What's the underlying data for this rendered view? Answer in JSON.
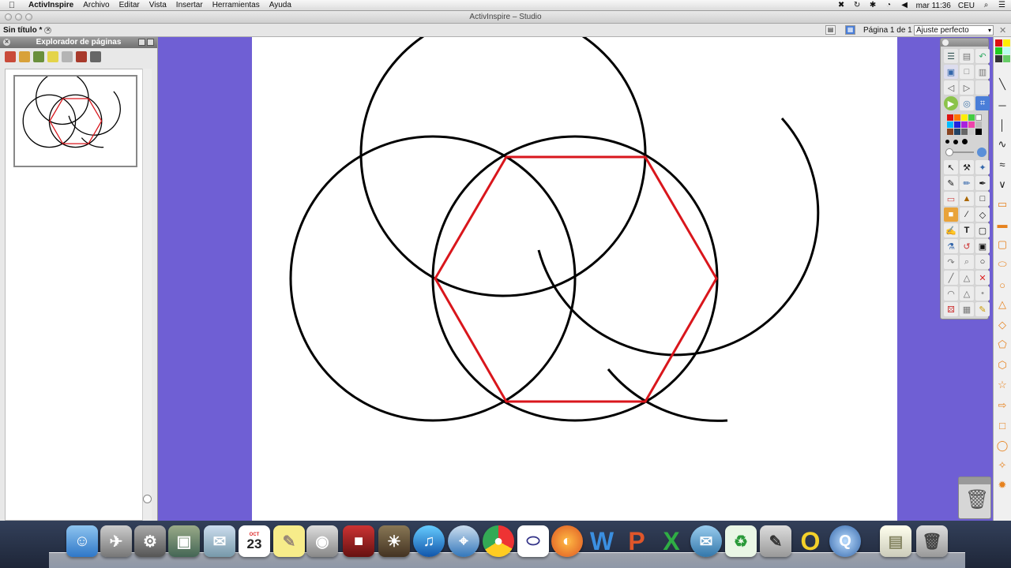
{
  "menubar": {
    "app_name": "ActivInspire",
    "items": [
      "Archivo",
      "Editar",
      "Vista",
      "Insertar",
      "Herramientas",
      "Ayuda"
    ],
    "clock": "mar 11:36",
    "user": "CEU"
  },
  "window": {
    "title": "ActivInspire – Studio"
  },
  "document": {
    "tab_label": "Sin título *",
    "page_info": "Página 1 de 1",
    "zoom": "Ajuste perfecto"
  },
  "explorer": {
    "title": "Explorador de páginas"
  },
  "colors": {
    "canvas_background": "#6f5fd4",
    "stroke": "#000000",
    "hexagon": "#d9161c"
  },
  "dock": {
    "calendar_month": "OCT",
    "calendar_day": "23"
  }
}
